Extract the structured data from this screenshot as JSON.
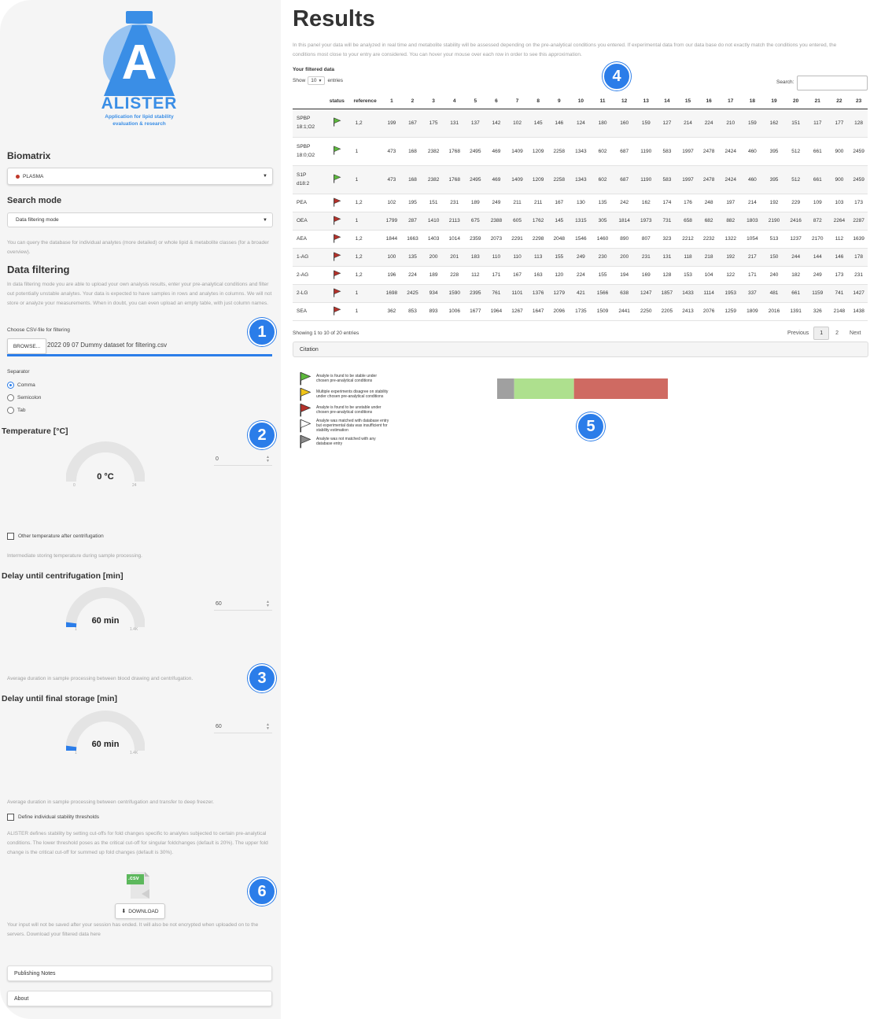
{
  "logo": {
    "letter": "A",
    "name": "ALISTER",
    "tagline_line1": "Application for lipid stability",
    "tagline_line2": "evaluation & research"
  },
  "sidebar": {
    "biomatrix_label": "Biomatrix",
    "biomatrix_value": "PLASMA",
    "search_mode_label": "Search mode",
    "search_mode_value": "Data filtering mode",
    "search_mode_help": "You can query the database for individual analytes (more detailed) or whole lipid & metabolite classes (for a broader overview).",
    "data_filtering_title": "Data filtering",
    "data_filtering_help": "In data filtering mode you are able to upload your own analysis results, enter your pre-analytical conditions and filter out potentially unstable analytes. Your data is expected to have samples in rows and analytes in columns. We will not store or analyze your measurements. When in doubt, you can even upload an empty table, with just column names.",
    "file_label": "Choose CSV-file for filtering",
    "browse_label": "BROWSE...",
    "file_name": "2022 09 07 Dummy dataset for filtering.csv",
    "separator_label": "Separator",
    "separator_options": [
      "Comma",
      "Semicolon",
      "Tab"
    ],
    "temperature_label": "Temperature [°C]",
    "temperature_gauge": {
      "value": "0 °C",
      "min": "0",
      "max": "24",
      "fraction": 0
    },
    "temperature_input": "0",
    "other_temp_label": "Other temperature after centrifugation",
    "intermediate_help": "Intermediate storing temperature during sample processing.",
    "delay_centrifugation_label": "Delay until centrifugation [min]",
    "delay_centrifugation_gauge": {
      "value": "60 min",
      "min": "1",
      "max": "1.4K",
      "fraction": 0.04
    },
    "delay_centrifugation_input": "60",
    "delay_centrifugation_help": "Average duration in sample processing between blood drawing and centrifugation.",
    "delay_storage_label": "Delay until final storage [min]",
    "delay_storage_gauge": {
      "value": "60 min",
      "min": "1",
      "max": "1.4K",
      "fraction": 0.04
    },
    "delay_storage_input": "60",
    "delay_storage_help": "Average duration in sample processing between centrifugation and transfer to deep freezer.",
    "thresholds_label": "Define individual stability thresholds",
    "thresholds_help": "ALISTER defines stability by setting cut-offs for fold changes specific to analytes subjected to certain pre-analytical conditions. The lower threshold poses as the critical cut-off for singular foldchanges (default is 20%). The upper fold change is the critical cut-off for summed up fold changes (default is 30%).",
    "csv_icon_text": ".csv",
    "download_label": "DOWNLOAD",
    "download_help": "Your input will not be saved after your session has ended. It will also be not encrypted when uploaded on to the servers. Download your filtered data here",
    "publishing_notes": "Publishing Notes",
    "about": "About"
  },
  "markers": [
    "1",
    "2",
    "3",
    "4",
    "5",
    "6"
  ],
  "main": {
    "title": "Results",
    "intro": "In this panel your data will be analyzed in real time and metabolite stability will be assessed depending on the pre-analytical conditions you entered. If experimental data from our data base do not exactly match the conditions you entered, the conditions most close to your entry are considered. You can hover your mouse over each row in order to see this approximation.",
    "filtered_label": "Your filtered data",
    "show_label": "Show",
    "show_value": "10",
    "entries_label": "entries",
    "search_label": "Search:",
    "columns": [
      "",
      "status",
      "reference",
      "1",
      "2",
      "3",
      "4",
      "5",
      "6",
      "7",
      "8",
      "9",
      "10",
      "11",
      "12",
      "13",
      "14",
      "15",
      "16",
      "17",
      "18",
      "19",
      "20",
      "21",
      "22",
      "23"
    ],
    "rows": [
      {
        "name1": "SPBP",
        "name2": "18:1;O2",
        "status": "stable",
        "reference": "1,2",
        "values": [
          "199",
          "167",
          "175",
          "131",
          "137",
          "142",
          "102",
          "145",
          "146",
          "124",
          "180",
          "160",
          "159",
          "127",
          "214",
          "224",
          "210",
          "159",
          "162",
          "151",
          "117",
          "177",
          "128"
        ]
      },
      {
        "name1": "SPBP",
        "name2": "18:0;O2",
        "status": "stable",
        "reference": "1",
        "values": [
          "473",
          "168",
          "2382",
          "1768",
          "2495",
          "469",
          "1409",
          "1209",
          "2258",
          "1343",
          "602",
          "687",
          "1190",
          "583",
          "1997",
          "2478",
          "2424",
          "460",
          "395",
          "512",
          "661",
          "900",
          "2459"
        ]
      },
      {
        "name1": "S1P",
        "name2": "d18:2",
        "status": "stable",
        "reference": "1",
        "values": [
          "473",
          "168",
          "2382",
          "1768",
          "2495",
          "469",
          "1409",
          "1209",
          "2258",
          "1343",
          "602",
          "687",
          "1190",
          "583",
          "1997",
          "2478",
          "2424",
          "460",
          "395",
          "512",
          "661",
          "900",
          "2459"
        ]
      },
      {
        "name1": "PEA",
        "name2": "",
        "status": "unstable",
        "reference": "1,2",
        "values": [
          "102",
          "195",
          "151",
          "231",
          "189",
          "249",
          "211",
          "211",
          "167",
          "130",
          "135",
          "242",
          "162",
          "174",
          "176",
          "248",
          "197",
          "214",
          "192",
          "229",
          "109",
          "103",
          "173"
        ]
      },
      {
        "name1": "OEA",
        "name2": "",
        "status": "unstable",
        "reference": "1",
        "values": [
          "1799",
          "287",
          "1410",
          "2113",
          "675",
          "2388",
          "605",
          "1762",
          "145",
          "1315",
          "305",
          "1814",
          "1973",
          "731",
          "658",
          "682",
          "882",
          "1803",
          "2190",
          "2416",
          "872",
          "2264",
          "2287"
        ]
      },
      {
        "name1": "AEA",
        "name2": "",
        "status": "unstable",
        "reference": "1,2",
        "values": [
          "1844",
          "1663",
          "1403",
          "1014",
          "2359",
          "2073",
          "2291",
          "2298",
          "2048",
          "1546",
          "1460",
          "890",
          "807",
          "323",
          "2212",
          "2232",
          "1322",
          "1054",
          "513",
          "1237",
          "2170",
          "112",
          "1639"
        ]
      },
      {
        "name1": "1-AG",
        "name2": "",
        "status": "unstable",
        "reference": "1,2",
        "values": [
          "100",
          "135",
          "200",
          "201",
          "183",
          "110",
          "110",
          "113",
          "155",
          "249",
          "230",
          "200",
          "231",
          "131",
          "118",
          "218",
          "192",
          "217",
          "150",
          "244",
          "144",
          "146",
          "178"
        ]
      },
      {
        "name1": "2-AG",
        "name2": "",
        "status": "unstable",
        "reference": "1,2",
        "values": [
          "196",
          "224",
          "189",
          "228",
          "112",
          "171",
          "167",
          "163",
          "120",
          "224",
          "155",
          "194",
          "169",
          "128",
          "153",
          "104",
          "122",
          "171",
          "240",
          "182",
          "249",
          "173",
          "231"
        ]
      },
      {
        "name1": "2-LG",
        "name2": "",
        "status": "unstable",
        "reference": "1",
        "values": [
          "1698",
          "2425",
          "934",
          "1590",
          "2395",
          "761",
          "1101",
          "1376",
          "1279",
          "421",
          "1566",
          "638",
          "1247",
          "1857",
          "1433",
          "1114",
          "1953",
          "337",
          "481",
          "661",
          "1159",
          "741",
          "1427"
        ]
      },
      {
        "name1": "SEA",
        "name2": "",
        "status": "unstable",
        "reference": "1",
        "values": [
          "362",
          "853",
          "893",
          "1006",
          "1677",
          "1964",
          "1267",
          "1647",
          "2096",
          "1735",
          "1509",
          "2441",
          "2250",
          "2205",
          "2413",
          "2076",
          "1259",
          "1809",
          "2016",
          "1391",
          "326",
          "2148",
          "1438"
        ]
      }
    ],
    "showing_text": "Showing 1 to 10 of 20 entries",
    "pagination": {
      "previous": "Previous",
      "page1": "1",
      "page2": "2",
      "next": "Next"
    },
    "citation_label": "Citation",
    "legend": [
      {
        "flag": "green",
        "line1": "Analyte is found to be stable under",
        "line2": "chosen pre-analytical conditions",
        "line3": ""
      },
      {
        "flag": "yellow",
        "line1": "Multiple experiments disagree on stability",
        "line2": "under chosen pre-analytical conditions",
        "line3": ""
      },
      {
        "flag": "red",
        "line1": "Analyte is found to be unstable under",
        "line2": "chosen pre-analytical conditions",
        "line3": ""
      },
      {
        "flag": "white",
        "line1": "Analyte was matched with database entry",
        "line2": "but experimental data was insufficient for",
        "line3": "stability estimation"
      },
      {
        "flag": "grey",
        "line1": "Analyte was not matched with any",
        "line2": "database entry",
        "line3": ""
      }
    ]
  },
  "chart_data": {
    "type": "bar",
    "orientation": "horizontal-stacked",
    "series": [
      {
        "status": "not matched",
        "fraction": 0.1,
        "color": "#a0a0a0"
      },
      {
        "status": "stable",
        "fraction": 0.35,
        "color": "#aee08e"
      },
      {
        "status": "unstable",
        "fraction": 0.55,
        "color": "#cf6a62"
      }
    ]
  },
  "colors": {
    "accent": "#2b7de9",
    "flag_green": "#5cb83c",
    "flag_red": "#b5312a",
    "flag_yellow": "#f0c419",
    "flag_grey": "#8a8a8a",
    "logo_blue": "#3a8ee6"
  }
}
